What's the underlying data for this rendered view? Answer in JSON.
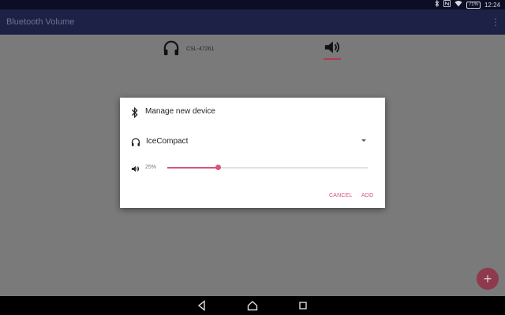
{
  "status_bar": {
    "time": "12:24",
    "battery": "71%"
  },
  "app_bar": {
    "title": "Bluetooth Volume"
  },
  "device_list": {
    "device_name": "CSL-47261"
  },
  "dialog": {
    "title": "Manage new device",
    "device": "IceCompact",
    "volume_percent_label": "25%",
    "volume_level": 0.25,
    "cancel_label": "CANCEL",
    "add_label": "ADD"
  },
  "fab": {
    "label": "+"
  },
  "colors": {
    "accent": "#d9537a",
    "app_bar": "#1d2146",
    "scrim_background": "#7a7a7a"
  }
}
